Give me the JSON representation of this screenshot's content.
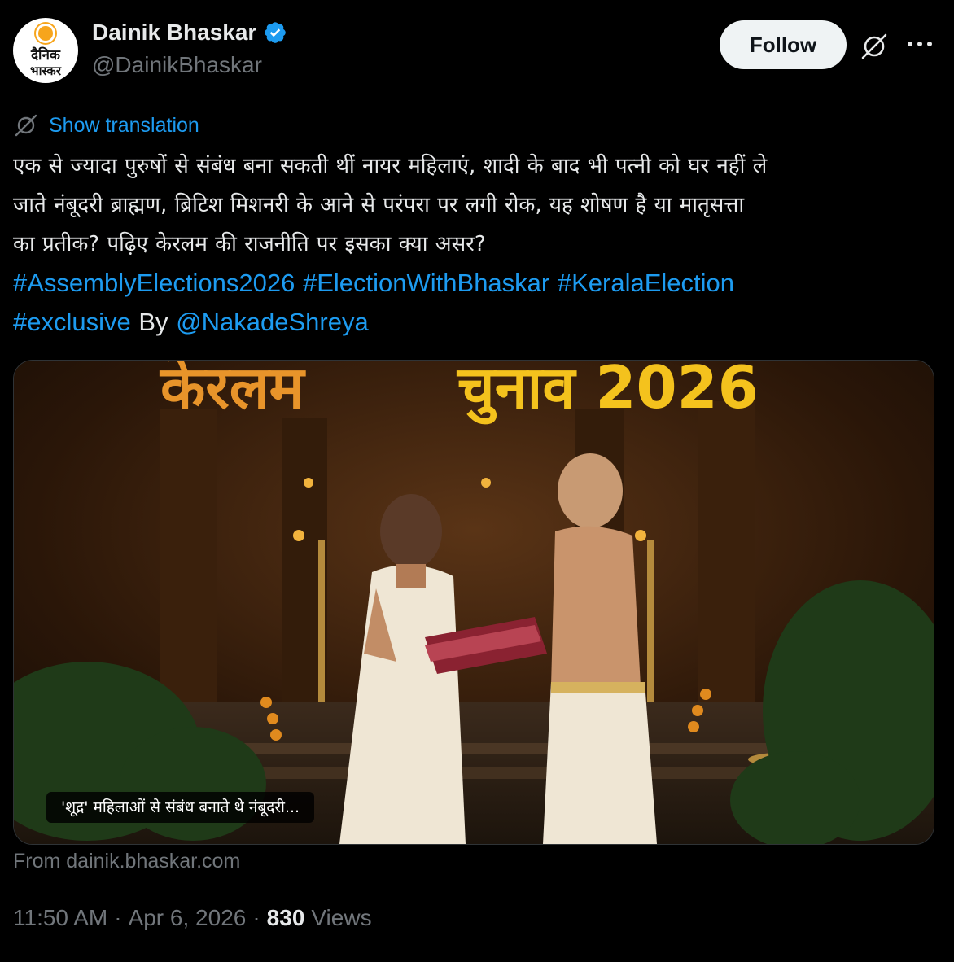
{
  "account": {
    "display_name": "Dainik Bhaskar",
    "handle": "@DainikBhaskar",
    "avatar_line1": "दैनिक",
    "avatar_line2": "भास्कर",
    "verified": true
  },
  "actions": {
    "follow_label": "Follow"
  },
  "translation": {
    "label": "Show translation"
  },
  "tweet": {
    "line1": "एक से ज्यादा पुरुषों से संबंध बना सकती थीं नायर महिलाएं, शादी के बाद भी पत्नी को घर नहीं ले",
    "line2": "जाते नंबूदरी ब्राह्मण, ब्रिटिश मिशनरी के आने से परंपरा पर लगी रोक, यह शोषण है या मातृसत्ता",
    "line3": "का प्रतीक? पढ़िए केरलम की राजनीति पर इसका क्या असर?",
    "hashtags": [
      "#AssemblyElections2026",
      "#ElectionWithBhaskar",
      "#KeralaElection",
      "#exclusive"
    ],
    "by_label": "By",
    "mention": "@NakadeShreya"
  },
  "media": {
    "banner_text_left": "केरलम",
    "banner_text_right": "चुनाव 2026",
    "caption": "'शूद्र' महिलाओं से संबंध बनाते थे नंबूदरी..."
  },
  "source": "From dainik.bhaskar.com",
  "meta": {
    "time": "11:50 AM",
    "separator": "·",
    "date": "Apr 6, 2026",
    "views_count": "830",
    "views_label": "Views"
  },
  "colors": {
    "background": "#000000",
    "text": "#e7e9ea",
    "muted": "#71767b",
    "link": "#1d9bf0",
    "verified": "#1d9bf0",
    "banner": "#f4a81d"
  },
  "icons": [
    "verified-badge-icon",
    "grok-icon",
    "more-icon",
    "translate-icon"
  ]
}
